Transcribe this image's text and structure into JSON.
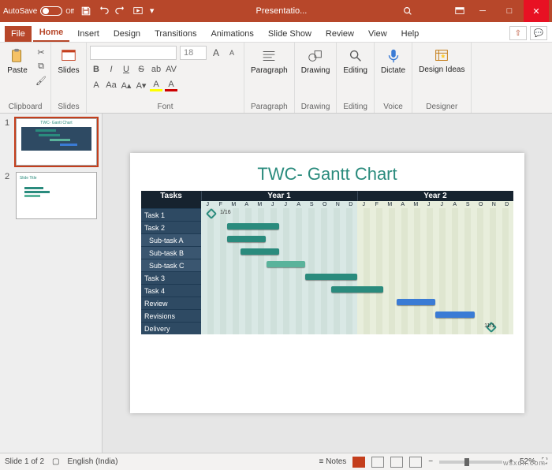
{
  "title_bar": {
    "autosave_label": "AutoSave",
    "autosave_state": "Off",
    "document_title": "Presentatio..."
  },
  "tabs": [
    "File",
    "Home",
    "Insert",
    "Design",
    "Transitions",
    "Animations",
    "Slide Show",
    "Review",
    "View",
    "Help"
  ],
  "active_tab": "Home",
  "ribbon": {
    "clipboard": {
      "paste": "Paste",
      "label": "Clipboard"
    },
    "slides": {
      "btn": "Slides",
      "label": "Slides"
    },
    "font": {
      "font_name_placeholder": "",
      "font_size_placeholder": "18",
      "bold": "B",
      "italic": "I",
      "underline": "U",
      "strike": "S",
      "spacing": "AV",
      "case": "Aa",
      "clear": "A",
      "grow": "A",
      "shrink": "A",
      "color": "A",
      "highlight": "A",
      "label": "Font"
    },
    "paragraph": {
      "btn": "Paragraph",
      "label": "Paragraph"
    },
    "drawing": {
      "btn": "Drawing",
      "label": "Drawing"
    },
    "editing": {
      "btn": "Editing",
      "label": "Editing"
    },
    "voice": {
      "btn": "Dictate",
      "label": "Voice"
    },
    "designer": {
      "btn": "Design Ideas",
      "label": "Designer"
    }
  },
  "thumbnails": [
    {
      "num": "1",
      "title": "TWC- Gantt Chart"
    },
    {
      "num": "2",
      "title": "Slide Title"
    }
  ],
  "slide": {
    "title": "TWC- Gantt Chart",
    "tasks_header": "Tasks",
    "year1": "Year 1",
    "year2": "Year 2",
    "months": [
      "J",
      "F",
      "M",
      "A",
      "M",
      "J",
      "J",
      "A",
      "S",
      "O",
      "N",
      "D"
    ],
    "rows": [
      "Task 1",
      "Task 2",
      "Sub-task A",
      "Sub-task B",
      "Sub-task C",
      "Task 3",
      "Task 4",
      "Review",
      "Revisions",
      "Delivery"
    ],
    "start_marker": "1/16",
    "end_marker": "11/1"
  },
  "chart_data": {
    "type": "gantt",
    "title": "TWC- Gantt Chart",
    "x_axis": {
      "unit": "month",
      "range": [
        "Year1-Jan",
        "Year2-Dec"
      ],
      "tick_labels": [
        "J",
        "F",
        "M",
        "A",
        "M",
        "J",
        "J",
        "A",
        "S",
        "O",
        "N",
        "D",
        "J",
        "F",
        "M",
        "A",
        "M",
        "J",
        "J",
        "A",
        "S",
        "O",
        "N",
        "D"
      ]
    },
    "milestones": [
      {
        "label": "1/16",
        "month_index": 0.5
      },
      {
        "label": "11/1",
        "month_index": 22
      }
    ],
    "tasks": [
      {
        "name": "Task 1",
        "start": 0.5,
        "end": 0.5,
        "type": "milestone"
      },
      {
        "name": "Task 2",
        "start": 2,
        "end": 6,
        "color": "green"
      },
      {
        "name": "Sub-task A",
        "start": 2,
        "end": 5,
        "color": "green",
        "sub": true
      },
      {
        "name": "Sub-task B",
        "start": 3,
        "end": 6,
        "color": "green",
        "sub": true
      },
      {
        "name": "Sub-task C",
        "start": 5,
        "end": 8,
        "color": "light-green",
        "sub": true
      },
      {
        "name": "Task 3",
        "start": 8,
        "end": 12,
        "color": "green"
      },
      {
        "name": "Task 4",
        "start": 10,
        "end": 14,
        "color": "green"
      },
      {
        "name": "Review",
        "start": 15,
        "end": 18,
        "color": "blue"
      },
      {
        "name": "Revisions",
        "start": 18,
        "end": 21,
        "color": "blue"
      },
      {
        "name": "Delivery",
        "start": 22,
        "end": 22,
        "type": "milestone"
      }
    ]
  },
  "status": {
    "slide_count": "Slide 1 of 2",
    "language": "English (India)",
    "notes": "Notes",
    "zoom": "52%"
  },
  "watermark": "wsxdn.com"
}
